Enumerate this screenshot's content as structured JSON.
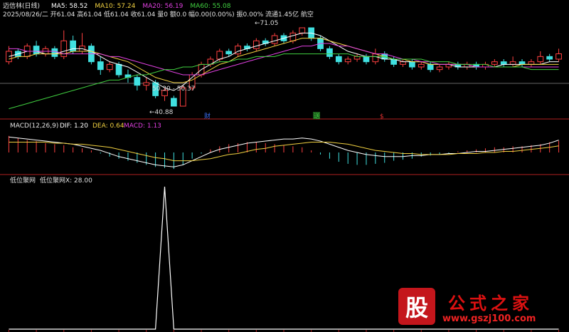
{
  "header": {
    "stock_name": "迈信林(日线)",
    "ma_items": [
      {
        "label": "MA5: 58.52",
        "color": "#ffffff"
      },
      {
        "label": "MA10: 57.24",
        "color": "#f0d040"
      },
      {
        "label": "MA20: 56.19",
        "color": "#e040e0"
      },
      {
        "label": "MA60: 55.08",
        "color": "#40d040"
      }
    ],
    "ohlc_line": "2025/08/26/二 开61.04 高61.04 低61.04 收61.04 量0 额0.0 幅0.00(0.00%) 振0.00% 流通1.45亿 航空"
  },
  "price_annotations": {
    "high_label": "71.05",
    "low_label": "40.88",
    "cursor_label": "50.30 - 50.37"
  },
  "event_markers": [
    {
      "text": "财",
      "color": "#3a6df0"
    },
    {
      "text": "送",
      "color": "#40c040"
    },
    {
      "text": "$",
      "color": "#e03030"
    }
  ],
  "macd_header": {
    "title": "MACD(12,26,9)",
    "dif": "DIF: 1.20",
    "dea": "DEA: 0.64",
    "macd": "MACD: 1.13",
    "dif_color": "#ffffff",
    "dea_color": "#f0d040",
    "macd_color": "#e040e0"
  },
  "indicator_header": {
    "title": "低位聚网",
    "value": "低位聚网X: 28.00"
  },
  "colors": {
    "up": "#ff4040",
    "down": "#40e0e0",
    "divider": "#b02020",
    "background": "#000000"
  },
  "chart_data": [
    {
      "type": "candlestick",
      "title": "迈信林(日线)",
      "series": [
        {
          "name": "MA5",
          "values": [
            60,
            61,
            62,
            62,
            61,
            61,
            62,
            63,
            63,
            62,
            60,
            58,
            57,
            56,
            54,
            52,
            50,
            48,
            47,
            49,
            52,
            55,
            57,
            59,
            60,
            62,
            63,
            64,
            65,
            66,
            67,
            68,
            69,
            69,
            68,
            66,
            64,
            62,
            61,
            60,
            60,
            59,
            59,
            58,
            58,
            58,
            57,
            57,
            57,
            56,
            56,
            56,
            56,
            56,
            57,
            57,
            57,
            57,
            57,
            58,
            58
          ]
        },
        {
          "name": "MA10",
          "values": [
            59,
            60,
            60,
            61,
            61,
            61,
            61,
            62,
            62,
            62,
            61,
            60,
            59,
            58,
            56,
            54,
            52,
            51,
            50,
            50,
            51,
            53,
            55,
            57,
            58,
            60,
            61,
            62,
            63,
            64,
            65,
            66,
            67,
            67,
            67,
            66,
            65,
            64,
            63,
            62,
            61,
            60,
            59,
            59,
            58,
            58,
            57,
            57,
            57,
            57,
            57,
            56,
            56,
            56,
            56,
            56,
            57,
            57,
            57,
            57,
            57
          ]
        },
        {
          "name": "MA20",
          "values": [
            63,
            63,
            62,
            62,
            62,
            62,
            61,
            61,
            61,
            61,
            61,
            60,
            60,
            59,
            58,
            57,
            56,
            55,
            54,
            53,
            53,
            53,
            54,
            55,
            56,
            57,
            58,
            59,
            60,
            61,
            62,
            63,
            64,
            64,
            65,
            65,
            64,
            64,
            63,
            62,
            61,
            61,
            60,
            59,
            59,
            58,
            58,
            57,
            57,
            57,
            57,
            56,
            56,
            56,
            56,
            56,
            56,
            56,
            56,
            56,
            56
          ]
        },
        {
          "name": "MA60",
          "values": [
            40,
            41,
            42,
            43,
            44,
            45,
            46,
            47,
            48,
            49,
            50,
            51,
            51,
            52,
            53,
            53,
            54,
            55,
            55,
            56,
            56,
            57,
            57,
            58,
            58,
            59,
            59,
            60,
            60,
            60,
            61,
            61,
            61,
            61,
            61,
            61,
            61,
            61,
            60,
            60,
            60,
            60,
            59,
            59,
            59,
            59,
            58,
            58,
            58,
            57,
            57,
            57,
            57,
            56,
            56,
            56,
            56,
            55,
            55,
            55,
            55
          ]
        }
      ],
      "bars": [
        {
          "o": 58,
          "c": 62,
          "h": 64,
          "l": 57
        },
        {
          "o": 62,
          "c": 60,
          "h": 63,
          "l": 59
        },
        {
          "o": 60,
          "c": 64,
          "h": 65,
          "l": 59
        },
        {
          "o": 64,
          "c": 61,
          "h": 66,
          "l": 60
        },
        {
          "o": 61,
          "c": 63,
          "h": 64,
          "l": 60
        },
        {
          "o": 63,
          "c": 60,
          "h": 64,
          "l": 59
        },
        {
          "o": 60,
          "c": 66,
          "h": 70,
          "l": 59
        },
        {
          "o": 66,
          "c": 62,
          "h": 68,
          "l": 61
        },
        {
          "o": 62,
          "c": 64,
          "h": 69,
          "l": 61
        },
        {
          "o": 64,
          "c": 58,
          "h": 65,
          "l": 57
        },
        {
          "o": 58,
          "c": 55,
          "h": 60,
          "l": 53
        },
        {
          "o": 55,
          "c": 57,
          "h": 58,
          "l": 54
        },
        {
          "o": 57,
          "c": 53,
          "h": 58,
          "l": 52
        },
        {
          "o": 53,
          "c": 52,
          "h": 55,
          "l": 50
        },
        {
          "o": 52,
          "c": 49,
          "h": 53,
          "l": 47
        },
        {
          "o": 49,
          "c": 50,
          "h": 52,
          "l": 47
        },
        {
          "o": 50,
          "c": 45,
          "h": 51,
          "l": 44
        },
        {
          "o": 45,
          "c": 47,
          "h": 48,
          "l": 43
        },
        {
          "o": 44,
          "c": 41,
          "h": 45,
          "l": 40.88
        },
        {
          "o": 41,
          "c": 48,
          "h": 49,
          "l": 41
        },
        {
          "o": 48,
          "c": 53,
          "h": 54,
          "l": 47
        },
        {
          "o": 53,
          "c": 57,
          "h": 58,
          "l": 52
        },
        {
          "o": 57,
          "c": 59,
          "h": 60,
          "l": 56
        },
        {
          "o": 59,
          "c": 62,
          "h": 63,
          "l": 58
        },
        {
          "o": 62,
          "c": 61,
          "h": 63,
          "l": 60
        },
        {
          "o": 61,
          "c": 64,
          "h": 65,
          "l": 60
        },
        {
          "o": 64,
          "c": 63,
          "h": 65,
          "l": 62
        },
        {
          "o": 63,
          "c": 66,
          "h": 67,
          "l": 62
        },
        {
          "o": 66,
          "c": 65,
          "h": 67,
          "l": 64
        },
        {
          "o": 65,
          "c": 68,
          "h": 69,
          "l": 64
        },
        {
          "o": 68,
          "c": 66,
          "h": 69,
          "l": 65
        },
        {
          "o": 66,
          "c": 69,
          "h": 70,
          "l": 65
        },
        {
          "o": 69,
          "c": 71,
          "h": 71.05,
          "l": 68
        },
        {
          "o": 71,
          "c": 67,
          "h": 71,
          "l": 66
        },
        {
          "o": 67,
          "c": 63,
          "h": 68,
          "l": 62
        },
        {
          "o": 63,
          "c": 60,
          "h": 64,
          "l": 59
        },
        {
          "o": 60,
          "c": 58,
          "h": 61,
          "l": 57
        },
        {
          "o": 58,
          "c": 59,
          "h": 60,
          "l": 57
        },
        {
          "o": 59,
          "c": 60,
          "h": 61,
          "l": 58
        },
        {
          "o": 60,
          "c": 58,
          "h": 61,
          "l": 57
        },
        {
          "o": 58,
          "c": 61,
          "h": 63,
          "l": 57
        },
        {
          "o": 61,
          "c": 59,
          "h": 62,
          "l": 58
        },
        {
          "o": 59,
          "c": 57,
          "h": 60,
          "l": 56
        },
        {
          "o": 57,
          "c": 58,
          "h": 59,
          "l": 56
        },
        {
          "o": 58,
          "c": 56,
          "h": 59,
          "l": 55
        },
        {
          "o": 56,
          "c": 57,
          "h": 58,
          "l": 55
        },
        {
          "o": 57,
          "c": 55,
          "h": 58,
          "l": 54
        },
        {
          "o": 55,
          "c": 56,
          "h": 57,
          "l": 54
        },
        {
          "o": 56,
          "c": 57,
          "h": 58,
          "l": 55
        },
        {
          "o": 57,
          "c": 56,
          "h": 58,
          "l": 55
        },
        {
          "o": 56,
          "c": 57,
          "h": 58,
          "l": 55
        },
        {
          "o": 57,
          "c": 56,
          "h": 58,
          "l": 55
        },
        {
          "o": 56,
          "c": 57,
          "h": 58,
          "l": 55
        },
        {
          "o": 57,
          "c": 58,
          "h": 59,
          "l": 56
        },
        {
          "o": 58,
          "c": 57,
          "h": 59,
          "l": 56
        },
        {
          "o": 57,
          "c": 58,
          "h": 60,
          "l": 56
        },
        {
          "o": 58,
          "c": 57,
          "h": 59,
          "l": 56
        },
        {
          "o": 57,
          "c": 58,
          "h": 59,
          "l": 56
        },
        {
          "o": 58,
          "c": 60,
          "h": 62,
          "l": 57
        },
        {
          "o": 60,
          "c": 59,
          "h": 61,
          "l": 58
        },
        {
          "o": 59,
          "c": 61.04,
          "h": 63,
          "l": 58
        }
      ],
      "ylim": [
        38,
        74
      ]
    },
    {
      "type": "bar",
      "title": "MACD(12,26,9)",
      "series": [
        {
          "name": "MACD",
          "values": [
            1.6,
            1.4,
            1.2,
            1.1,
            0.9,
            0.8,
            0.7,
            0.5,
            0.4,
            0.2,
            -0.1,
            -0.4,
            -0.6,
            -0.8,
            -1.0,
            -1.2,
            -1.4,
            -1.5,
            -1.6,
            -1.2,
            -0.6,
            -0.1,
            0.3,
            0.6,
            0.8,
            0.9,
            1.0,
            1.0,
            0.9,
            0.8,
            0.7,
            0.6,
            0.5,
            0.2,
            -0.2,
            -0.6,
            -0.9,
            -1.1,
            -1.2,
            -1.2,
            -1.1,
            -1.0,
            -0.8,
            -0.7,
            -0.6,
            -0.4,
            -0.3,
            -0.2,
            -0.1,
            0.1,
            0.2,
            0.3,
            0.4,
            0.5,
            0.5,
            0.6,
            0.6,
            0.7,
            0.8,
            1.0,
            1.13
          ]
        },
        {
          "name": "DIF",
          "values": [
            1.5,
            1.4,
            1.3,
            1.2,
            1.1,
            1.0,
            0.9,
            0.8,
            0.6,
            0.4,
            0.2,
            -0.1,
            -0.4,
            -0.6,
            -0.8,
            -1.0,
            -1.2,
            -1.3,
            -1.4,
            -1.2,
            -0.8,
            -0.4,
            0.0,
            0.3,
            0.5,
            0.7,
            0.9,
            1.0,
            1.1,
            1.2,
            1.3,
            1.3,
            1.4,
            1.3,
            1.1,
            0.8,
            0.5,
            0.2,
            0.0,
            -0.2,
            -0.3,
            -0.4,
            -0.4,
            -0.4,
            -0.3,
            -0.3,
            -0.2,
            -0.2,
            -0.1,
            -0.1,
            0.0,
            0.1,
            0.1,
            0.2,
            0.3,
            0.4,
            0.5,
            0.6,
            0.7,
            0.9,
            1.2
          ]
        },
        {
          "name": "DEA",
          "values": [
            1.0,
            1.0,
            1.0,
            1.0,
            1.0,
            0.9,
            0.9,
            0.8,
            0.8,
            0.7,
            0.6,
            0.5,
            0.3,
            0.1,
            -0.1,
            -0.3,
            -0.5,
            -0.6,
            -0.8,
            -0.8,
            -0.8,
            -0.7,
            -0.6,
            -0.4,
            -0.2,
            -0.1,
            0.1,
            0.3,
            0.4,
            0.6,
            0.7,
            0.8,
            0.9,
            1.0,
            1.0,
            1.0,
            0.9,
            0.8,
            0.6,
            0.4,
            0.2,
            0.1,
            0.0,
            -0.1,
            -0.1,
            -0.2,
            -0.2,
            -0.2,
            -0.2,
            -0.1,
            -0.1,
            -0.1,
            0.0,
            0.0,
            0.1,
            0.1,
            0.2,
            0.3,
            0.4,
            0.5,
            0.64
          ]
        }
      ],
      "ylim": [
        -2.0,
        2.0
      ]
    },
    {
      "type": "line",
      "title": "低位聚网",
      "series": [
        {
          "name": "低位聚网X",
          "values": [
            0,
            0,
            0,
            0,
            0,
            0,
            0,
            0,
            0,
            0,
            0,
            0,
            0,
            0,
            0,
            0,
            0,
            28,
            0,
            0,
            0,
            0,
            0,
            0,
            0,
            0,
            0,
            0,
            0,
            0,
            0,
            0,
            0,
            0,
            0,
            0,
            0,
            0,
            0,
            0,
            0,
            0,
            0,
            0,
            0,
            0,
            0,
            0,
            0,
            0,
            0,
            0,
            0,
            0,
            0,
            0,
            0,
            0,
            0,
            0,
            0
          ]
        }
      ],
      "ylim": [
        0,
        28
      ]
    }
  ],
  "watermark": {
    "icon_text": "股",
    "title": "公式之家",
    "url": "www.gszj100.com"
  }
}
